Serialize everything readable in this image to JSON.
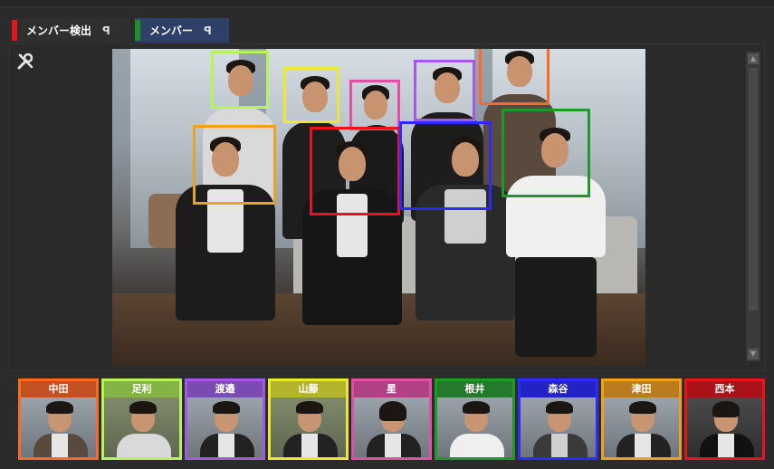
{
  "tabs": [
    {
      "label": "メンバー検出",
      "accent": "#e8141c",
      "pin": "ꟼ"
    },
    {
      "label": "メンバー",
      "accent": "#1f8f2a",
      "pin": "ꟼ"
    }
  ],
  "toolbar": {
    "tools_icon": "wrench-screwdriver-icon"
  },
  "detections": [
    {
      "color": "#b6f55a"
    },
    {
      "color": "#e9e934"
    },
    {
      "color": "#e24fa6"
    },
    {
      "color": "#a25ae6"
    },
    {
      "color": "#ff6a1f"
    },
    {
      "color": "#f0a11c"
    },
    {
      "color": "#e8141c"
    },
    {
      "color": "#2b2bff"
    },
    {
      "color": "#1f9a2a"
    }
  ],
  "members": [
    {
      "name": "中田",
      "color": "#ff6a1f",
      "label_bg": "#c25021"
    },
    {
      "name": "足利",
      "color": "#b6f55a",
      "label_bg": "#86b346"
    },
    {
      "name": "渡邉",
      "color": "#a25ae6",
      "label_bg": "#7a4bb0"
    },
    {
      "name": "山藤",
      "color": "#e9e934",
      "label_bg": "#b4b42b"
    },
    {
      "name": "星",
      "color": "#e24fa6",
      "label_bg": "#b04185"
    },
    {
      "name": "根井",
      "color": "#1f9a2a",
      "label_bg": "#237a2a"
    },
    {
      "name": "森谷",
      "color": "#2b2bff",
      "label_bg": "#2323c4"
    },
    {
      "name": "津田",
      "color": "#f0a11c",
      "label_bg": "#bb7d1c"
    },
    {
      "name": "西本",
      "color": "#e8141c",
      "label_bg": "#a81218"
    }
  ]
}
